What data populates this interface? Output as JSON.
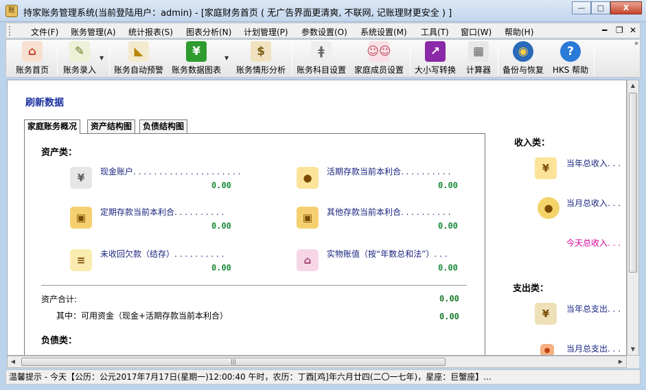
{
  "window": {
    "title": "持家账务管理系统(当前登陆用户：admin) - [家庭财务首页 ( 无广告界面更清爽, 不联网, 记账理财更安全 ) ]",
    "app_icon_glyph": "账",
    "minimize_glyph": "—",
    "maximize_glyph": "□",
    "close_glyph": "X"
  },
  "menu": {
    "items": [
      "文件(F)",
      "账务管理(A)",
      "统计报表(S)",
      "图表分析(N)",
      "计划管理(P)",
      "参数设置(O)",
      "系统设置(M)",
      "工具(T)",
      "窗口(W)",
      "帮助(H)"
    ],
    "mdi_minimize": "━",
    "mdi_restore": "❐",
    "mdi_close": "✕"
  },
  "toolbar": {
    "buttons": [
      {
        "label": "账务首页",
        "icon": "house-icon",
        "glyph": "⌂",
        "color": "#c8452b"
      },
      {
        "label": "账务录入",
        "icon": "pencil-icon",
        "glyph": "✎",
        "color": "#6b7d2a"
      },
      {
        "label": "账务自动预警",
        "icon": "megaphone-icon",
        "glyph": "📢",
        "color": "#b8860b"
      },
      {
        "label": "账务数据图表",
        "icon": "chart-icon",
        "glyph": "¥",
        "color": "#2e9b2e"
      },
      {
        "label": "账务情形分析",
        "icon": "money-bag-icon",
        "glyph": "$",
        "color": "#a07828"
      },
      {
        "label": "账务科目设置",
        "icon": "fork-knife-icon",
        "glyph": "🍴",
        "color": "#888888"
      },
      {
        "label": "家庭成员设置",
        "icon": "family-icon",
        "glyph": "👫",
        "color": "#c04a60"
      },
      {
        "label": "大小写转换",
        "icon": "convert-icon",
        "glyph": "↗",
        "color": "#8a2aa8"
      },
      {
        "label": "计算器",
        "icon": "calculator-icon",
        "glyph": "▦",
        "color": "#9a9a9a"
      },
      {
        "label": "备份与恢复",
        "icon": "globe-icon",
        "glyph": "◉",
        "color": "#2a6ab8"
      },
      {
        "label": "HKS 帮助",
        "icon": "help-icon",
        "glyph": "?",
        "color": "#2a7ad8"
      }
    ],
    "dropdown_glyph": "▼",
    "overflow_glyph": "»"
  },
  "content": {
    "refresh_label": "刷新数据",
    "tabs": [
      "家庭账务概况",
      "资产结构图",
      "负债结构图"
    ],
    "assets_title": "资产类：",
    "assets": [
      {
        "label": "现金账户. . . . . . . . . . . . . . . . . . . . .",
        "value": "0.00",
        "icon": "cash-icon",
        "glyph": "¥",
        "color": "#c8c8c8"
      },
      {
        "label": "活期存款当前本利合. . . . . . . . . .",
        "value": "0.00",
        "icon": "coins-icon",
        "glyph": "●",
        "color": "#f0c030"
      },
      {
        "label": "定期存款当前本利合. . . . . . . . . .",
        "value": "0.00",
        "icon": "treasure-chest-icon",
        "glyph": "▣",
        "color": "#e8a820"
      },
      {
        "label": "其他存款当前本利合. . . . . . . . . .",
        "value": "0.00",
        "icon": "treasure-chest-icon",
        "glyph": "▣",
        "color": "#e8a820"
      },
      {
        "label": "未收回欠款（结存）. . . . . . . . . .",
        "value": "0.00",
        "icon": "receipt-icon",
        "glyph": "≡",
        "color": "#f0d060"
      },
      {
        "label": "实物账值（按“年数总和法”）. . .",
        "value": "0.00",
        "icon": "house-goods-icon",
        "glyph": "⌂",
        "color": "#e0a0c0"
      }
    ],
    "asset_total_label": "资产合计:",
    "asset_total_value": "0.00",
    "available_label": "其中：可用资金（现金+活期存款当前本利合）",
    "available_value": "0.00",
    "liabilities_title": "负债类：",
    "income_title": "收入类：",
    "income": [
      {
        "label": "当年总收入. . .",
        "icon": "coins-stack-icon",
        "glyph": "¥",
        "color": "#f0c030",
        "highlight": false
      },
      {
        "label": "当月总收入. . .",
        "icon": "coin-icon",
        "glyph": "●",
        "color": "#e8b020",
        "highlight": false
      },
      {
        "label": "今天总收入. . .",
        "highlight": true
      }
    ],
    "expense_title": "支出类：",
    "expense": [
      {
        "label": "当年总支出. . .",
        "icon": "banknotes-icon",
        "glyph": "¥",
        "color": "#e0c080"
      },
      {
        "label": "当月总支出. . .",
        "icon": "coin-small-icon",
        "glyph": "●",
        "color": "#e87030"
      }
    ]
  },
  "scrollbar": {
    "up": "▲",
    "down": "▼",
    "left": "◀",
    "right": "▶",
    "grip": "|||"
  },
  "status": {
    "text": "温馨提示 - 今天【公历：公元2017年7月17日(星期一)12:00:40 午时，农历：丁酉[鸡]年六月廿四(二〇一七年)，星座：巨蟹座】..."
  }
}
